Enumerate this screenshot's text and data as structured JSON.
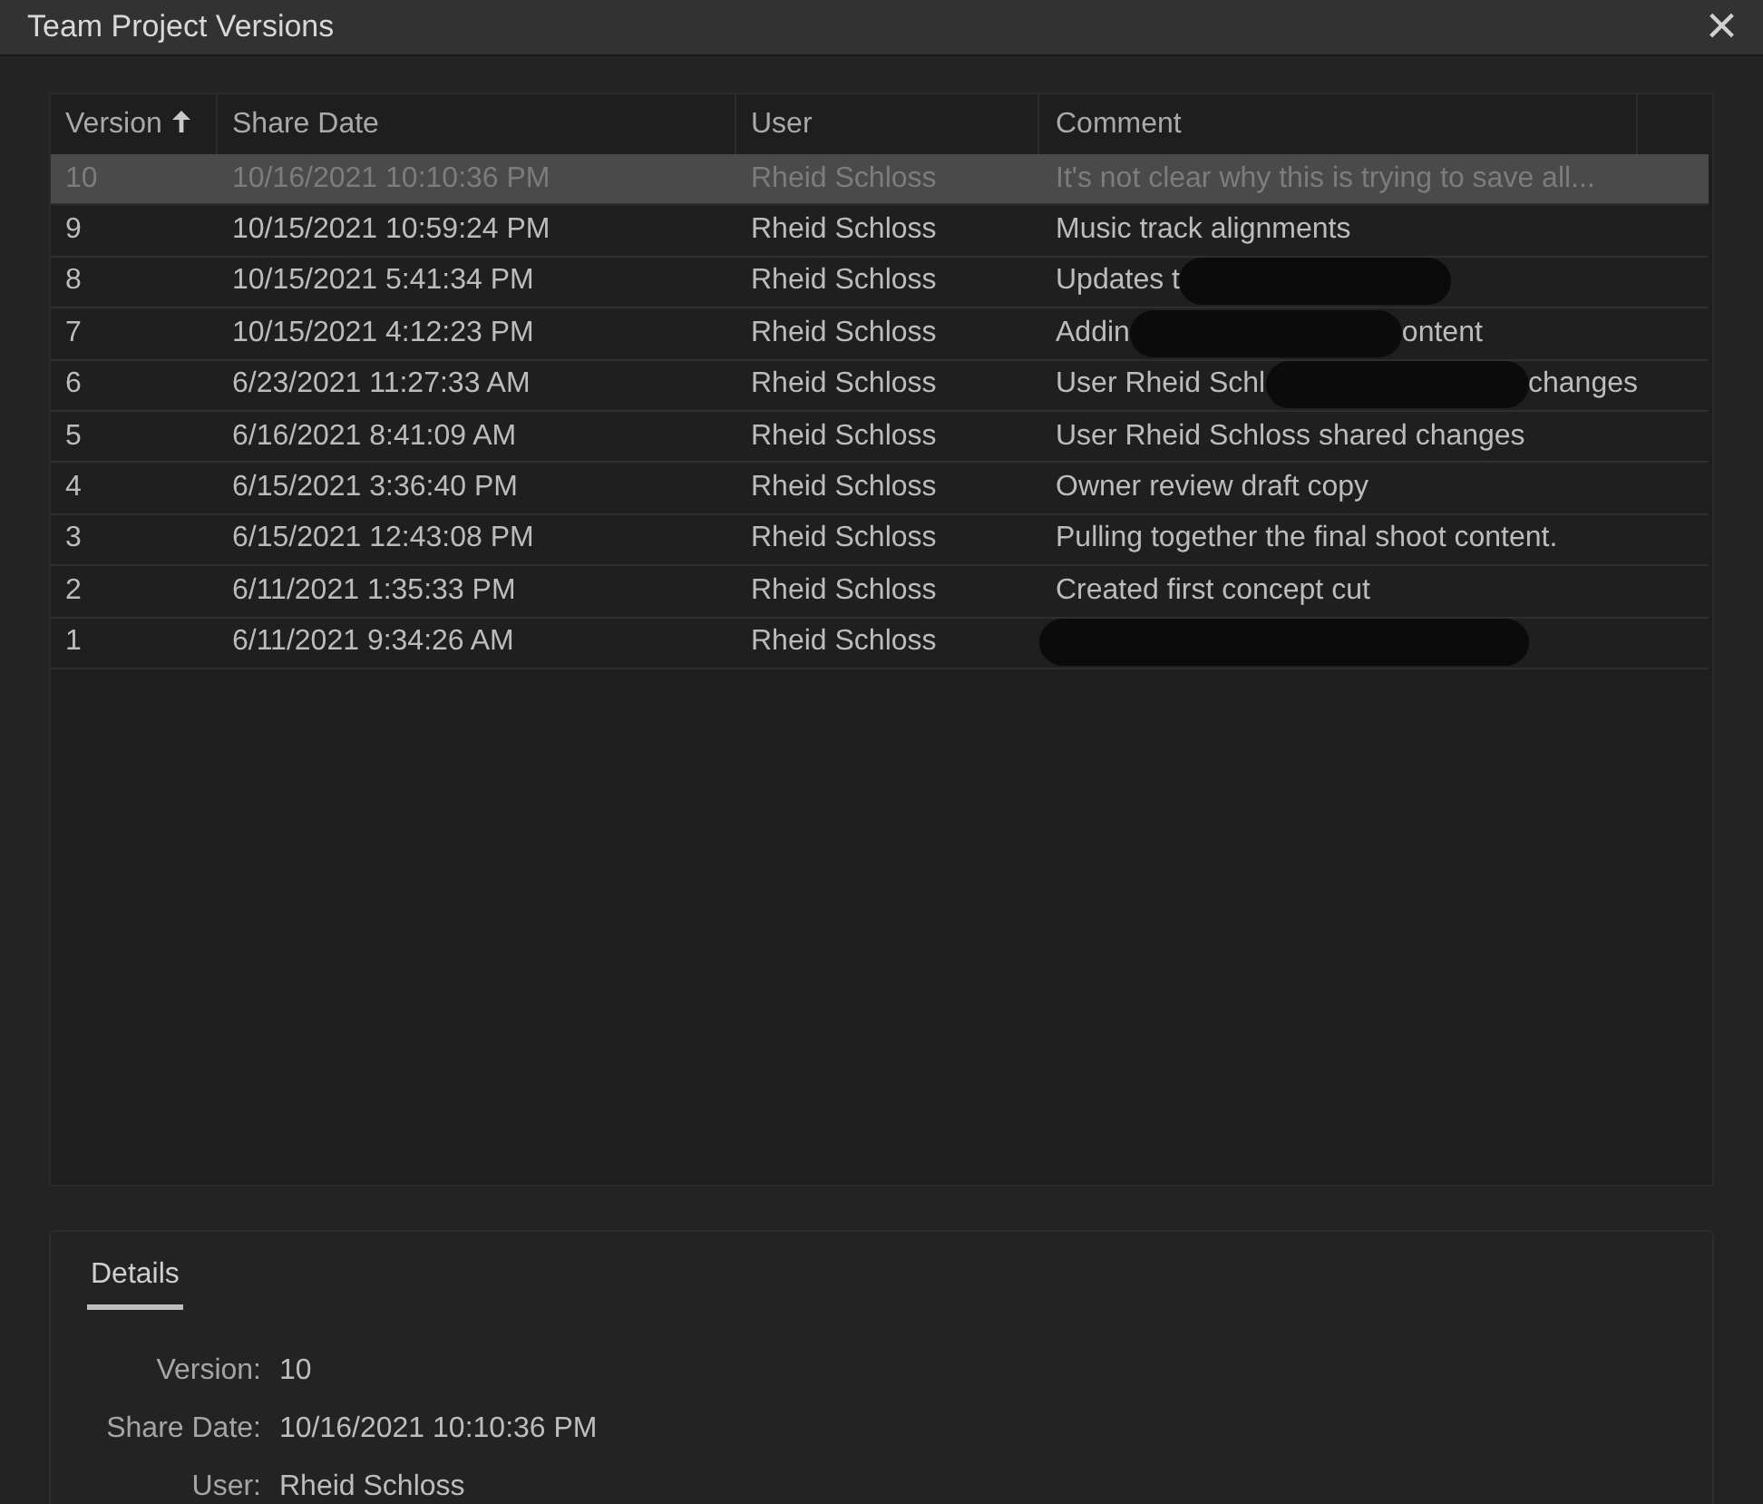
{
  "window": {
    "title": "Team Project Versions",
    "close": "×"
  },
  "table": {
    "columns": [
      {
        "label": "Version",
        "sorted": true
      },
      {
        "label": "Share Date"
      },
      {
        "label": "User"
      },
      {
        "label": "Comment"
      }
    ],
    "rows": [
      {
        "version": "10",
        "share_date": "10/16/2021 10:10:36 PM",
        "user": "Rheid Schloss",
        "comment": [
          {
            "kind": "text",
            "text": "It's not clear why this is trying to save all..."
          }
        ],
        "selected": true
      },
      {
        "version": "9",
        "share_date": "10/15/2021 10:59:24 PM",
        "user": "Rheid Schloss",
        "comment": [
          {
            "kind": "text",
            "text": "Music track alignments"
          }
        ],
        "selected": false
      },
      {
        "version": "8",
        "share_date": "10/15/2021 5:41:34 PM",
        "user": "Rheid Schloss",
        "comment": [
          {
            "kind": "text",
            "text": "Updates t"
          },
          {
            "kind": "redaction"
          }
        ],
        "selected": false
      },
      {
        "version": "7",
        "share_date": "10/15/2021 4:12:23 PM",
        "user": "Rheid Schloss",
        "comment": [
          {
            "kind": "text",
            "text": "Addin"
          },
          {
            "kind": "redaction"
          },
          {
            "kind": "text",
            "text": "ontent"
          }
        ],
        "selected": false
      },
      {
        "version": "6",
        "share_date": "6/23/2021 11:27:33 AM",
        "user": "Rheid Schloss",
        "comment": [
          {
            "kind": "text",
            "text": "User Rheid Schl"
          },
          {
            "kind": "redaction"
          },
          {
            "kind": "text",
            "text": "changes"
          }
        ],
        "selected": false
      },
      {
        "version": "5",
        "share_date": "6/16/2021 8:41:09 AM",
        "user": "Rheid Schloss",
        "comment": [
          {
            "kind": "text",
            "text": "User Rheid Schloss shared changes"
          }
        ],
        "selected": false
      },
      {
        "version": "4",
        "share_date": "6/15/2021 3:36:40 PM",
        "user": "Rheid Schloss",
        "comment": [
          {
            "kind": "text",
            "text": "Owner review draft copy"
          }
        ],
        "selected": false
      },
      {
        "version": "3",
        "share_date": "6/15/2021 12:43:08 PM",
        "user": "Rheid Schloss",
        "comment": [
          {
            "kind": "text",
            "text": "Pulling together the final shoot content."
          }
        ],
        "selected": false
      },
      {
        "version": "2",
        "share_date": "6/11/2021 1:35:33 PM",
        "user": "Rheid Schloss",
        "comment": [
          {
            "kind": "text",
            "text": "Created first concept cut"
          }
        ],
        "selected": false
      },
      {
        "version": "1",
        "share_date": "6/11/2021 9:34:26 AM",
        "user": "Rheid Schloss",
        "comment": [
          {
            "kind": "redaction"
          }
        ],
        "selected": false
      }
    ]
  },
  "details": {
    "tabs": [
      {
        "label": "Details",
        "selected": true
      }
    ],
    "fields": [
      {
        "label": "Version:",
        "value": "10"
      },
      {
        "label": "Share Date:",
        "value": "10/16/2021 10:10:36 PM"
      },
      {
        "label": "User:",
        "value": "Rheid Schloss"
      }
    ]
  }
}
